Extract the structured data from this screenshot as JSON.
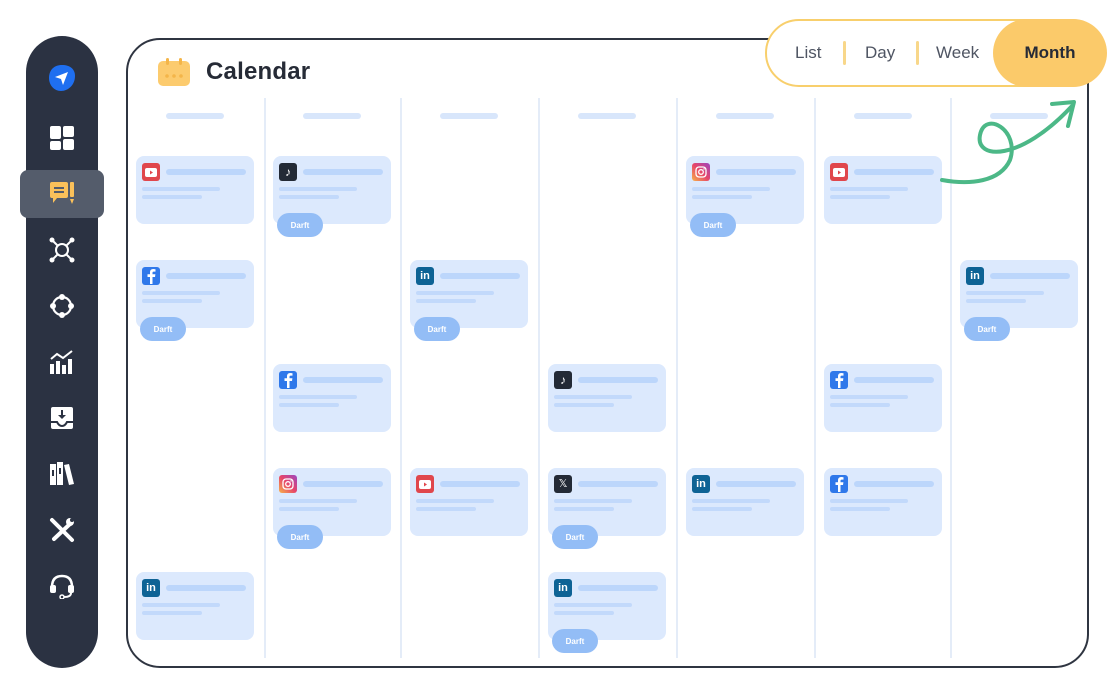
{
  "sidebar": {
    "items": [
      {
        "icon": "send-logo-icon",
        "active": false
      },
      {
        "icon": "dashboard-grid-icon",
        "active": false
      },
      {
        "icon": "posts-comment-icon",
        "active": true
      },
      {
        "icon": "network-hub-icon",
        "active": false
      },
      {
        "icon": "connections-cycle-icon",
        "active": false
      },
      {
        "icon": "analytics-chart-icon",
        "active": false
      },
      {
        "icon": "inbox-download-icon",
        "active": false
      },
      {
        "icon": "library-books-icon",
        "active": false
      },
      {
        "icon": "tools-wrench-icon",
        "active": false
      },
      {
        "icon": "support-headset-icon",
        "active": false
      }
    ]
  },
  "header": {
    "title": "Calendar",
    "title_icon": "calendar-icon"
  },
  "view_switcher": {
    "options": [
      "List",
      "Day",
      "Week",
      "Month"
    ],
    "selected": "Month"
  },
  "colors": {
    "accent": "#fbca6a",
    "sidebar_bg": "#2b3242",
    "card_bg": "#dce9fd",
    "badge_bg": "#93bdf6",
    "arrow": "#4cb887"
  },
  "draft_label": "Darft",
  "columns": [
    {
      "posts": [
        {
          "platform": "youtube",
          "slot": 0,
          "draft": false
        },
        {
          "platform": "facebook",
          "slot": 1,
          "draft": true
        },
        {
          "platform": "linkedin",
          "slot": 4,
          "draft": false
        }
      ]
    },
    {
      "posts": [
        {
          "platform": "tiktok",
          "slot": 0,
          "draft": true
        },
        {
          "platform": "facebook",
          "slot": 2,
          "draft": false
        },
        {
          "platform": "instagram",
          "slot": 3,
          "draft": true
        }
      ]
    },
    {
      "posts": [
        {
          "platform": "linkedin",
          "slot": 1,
          "draft": true
        },
        {
          "platform": "youtube",
          "slot": 3,
          "draft": false
        }
      ]
    },
    {
      "posts": [
        {
          "platform": "tiktok",
          "slot": 2,
          "draft": false
        },
        {
          "platform": "x",
          "slot": 3,
          "draft": true
        },
        {
          "platform": "linkedin",
          "slot": 4,
          "draft": true
        }
      ]
    },
    {
      "posts": [
        {
          "platform": "instagram",
          "slot": 0,
          "draft": true
        },
        {
          "platform": "linkedin",
          "slot": 3,
          "draft": false
        }
      ]
    },
    {
      "posts": [
        {
          "platform": "youtube",
          "slot": 0,
          "draft": false
        },
        {
          "platform": "facebook",
          "slot": 2,
          "draft": false
        },
        {
          "platform": "facebook",
          "slot": 3,
          "draft": false
        }
      ]
    },
    {
      "posts": [
        {
          "platform": "linkedin",
          "slot": 1,
          "draft": true
        }
      ]
    }
  ]
}
